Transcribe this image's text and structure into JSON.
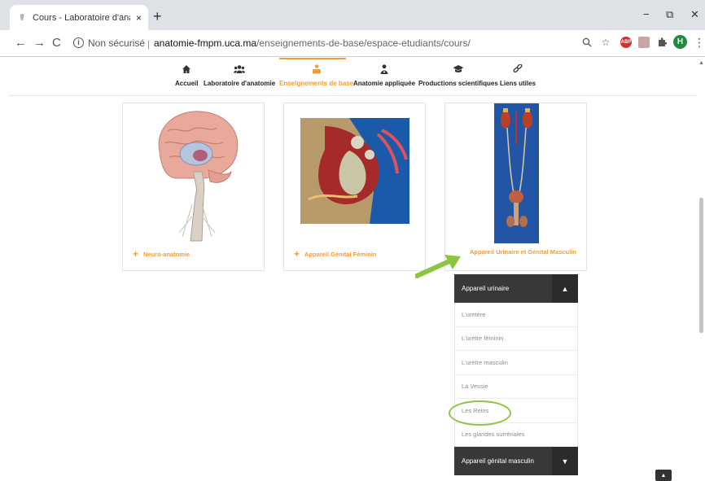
{
  "browser": {
    "tab_title": "Cours - Laboratoire d'anatomie",
    "tab_close": "×",
    "new_tab": "+",
    "window_minimize": "−",
    "window_restore": "⧉",
    "window_close": "✕",
    "back": "←",
    "forward": "→",
    "reload": "C",
    "security_label": "Non sécurisé",
    "url_host": "anatomie-fmpm.uca.ma",
    "url_path": "/enseignements-de-base/espace-etudiants/cours/",
    "profile_initial": "H",
    "ext_abp": "ABP"
  },
  "site_nav": {
    "items": [
      {
        "label": "Accueil",
        "icon": "home-icon"
      },
      {
        "label": "Laboratoire d'anatomie",
        "icon": "users-icon"
      },
      {
        "label": "Enseignements de base",
        "icon": "teacher-icon"
      },
      {
        "label": "Anatomie appliquée",
        "icon": "user-doctor-icon"
      },
      {
        "label": "Productions scientifiques",
        "icon": "graduation-cap-icon"
      },
      {
        "label": "Liens utiles",
        "icon": "link-icon"
      }
    ],
    "active": "Enseignements de base"
  },
  "cards": [
    {
      "label": "Neuro-anatomie",
      "image": "brain-illustration"
    },
    {
      "label": "Appareil Génital Féminin",
      "image": "female-pelvis-illustration"
    },
    {
      "label": "Appareil Urinaire et Génital Masculin",
      "image": "urinary-system-illustration"
    }
  ],
  "accordion": {
    "section1": "Appareil urinaire",
    "items": [
      "L'uretère",
      "L'urètre féminin",
      "L'urètre masculin",
      "La Vessie",
      "Les Reins",
      "Les glandes surrénales"
    ],
    "section2": "Appareil génital masculin",
    "highlighted": "Les Reins"
  },
  "colors": {
    "accent": "#f39c34",
    "annotation": "#8cc63f",
    "accordion_head": "#383838"
  }
}
